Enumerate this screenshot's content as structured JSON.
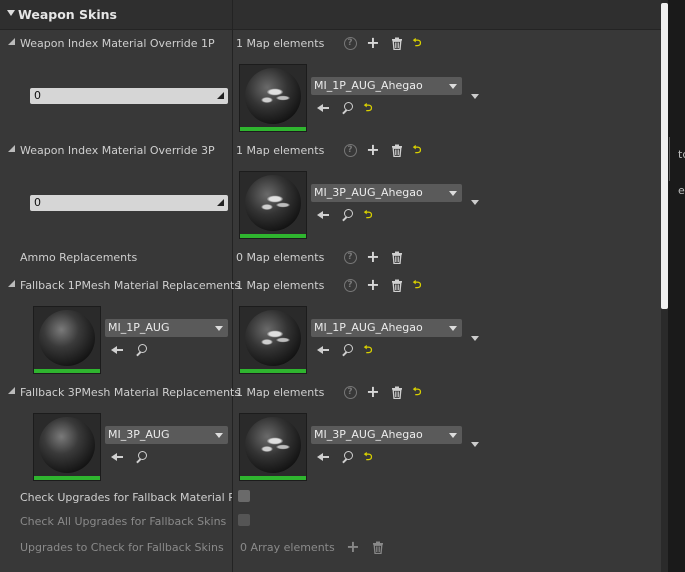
{
  "section": {
    "title": "Weapon Skins"
  },
  "rows": {
    "r1": {
      "label": "Weapon Index Material Override 1P",
      "count": "1 Map elements",
      "key_value": "0",
      "value_asset": "MI_1P_AUG_Ahegao"
    },
    "r2": {
      "label": "Weapon Index Material Override 3P",
      "count": "1 Map elements",
      "key_value": "0",
      "value_asset": "MI_3P_AUG_Ahegao"
    },
    "r3": {
      "label": "Ammo Replacements",
      "count": "0 Map elements"
    },
    "r4": {
      "label": "Fallback 1PMesh Material Replacements",
      "count": "1 Map elements",
      "key_asset": "MI_1P_AUG",
      "value_asset": "MI_1P_AUG_Ahegao"
    },
    "r5": {
      "label": "Fallback 3PMesh Material Replacements",
      "count": "1 Map elements",
      "key_asset": "MI_3P_AUG",
      "value_asset": "MI_3P_AUG_Ahegao"
    },
    "r6": {
      "label": "Check Upgrades for Fallback Material Repl"
    },
    "r7": {
      "label": "Check All Upgrades for Fallback Skins"
    },
    "r8": {
      "label": "Upgrades to Check for Fallback Skins",
      "count": "0 Array elements"
    }
  },
  "icons": {
    "help": "?",
    "reset": "⮌"
  },
  "side": {
    "t1": "tc",
    "t2": "e"
  },
  "colors": {
    "panel_bg": "#383838",
    "header_bg": "#2f2f2f",
    "thumbnail_bar": "#2fb52f",
    "reset_icon": "#d8d000"
  }
}
